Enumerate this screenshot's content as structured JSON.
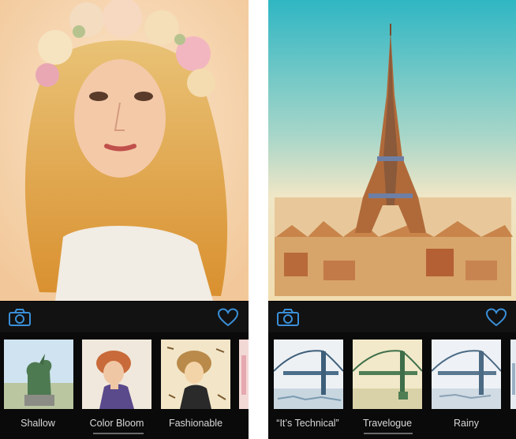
{
  "left_screen": {
    "toolbar": {
      "camera_icon": "camera-icon",
      "favorite_icon": "heart-icon",
      "accent": "#3a8fd8"
    },
    "filters": [
      {
        "label": "Shallow",
        "selected": false
      },
      {
        "label": "Color Bloom",
        "selected": true
      },
      {
        "label": "Fashionable",
        "selected": false
      }
    ]
  },
  "right_screen": {
    "toolbar": {
      "camera_icon": "camera-icon",
      "favorite_icon": "heart-icon",
      "accent": "#3a8fd8"
    },
    "filters": [
      {
        "label": "“It’s Technical”",
        "selected": false
      },
      {
        "label": "Travelogue",
        "selected": true
      },
      {
        "label": "Rainy",
        "selected": false
      }
    ]
  }
}
